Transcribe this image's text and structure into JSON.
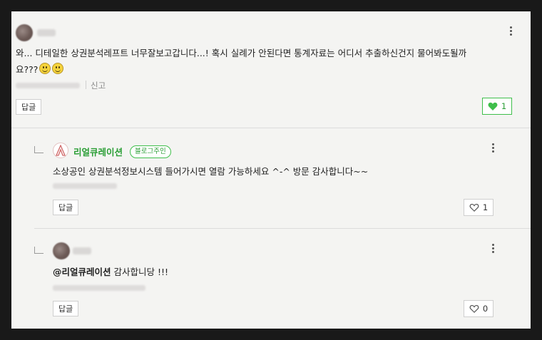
{
  "comments": [
    {
      "text": "와... 디테일한 상권분석레프트 너무잘보고갑니다...! 혹시 실례가 안된다면 통계자료는 어디서 추출하신건지 물어봐도될까",
      "text_line2": "요???",
      "report_label": "신고",
      "reply_label": "답글",
      "like_count": "1",
      "like_active": true
    }
  ],
  "replies": [
    {
      "author": "리얼큐레이션",
      "badge": "블로그주인",
      "text": "소상공인 상권분석정보시스템 들어가시면 열람 가능하세요 ^-^ 방문 감사합니다~~",
      "reply_label": "답글",
      "like_count": "1"
    },
    {
      "mention": "@리얼큐레이션",
      "text": "감사합니당 !!!",
      "reply_label": "답글",
      "like_count": "0"
    }
  ],
  "colors": {
    "accent": "#3fbf4b",
    "panel_bg": "#f4f4f2",
    "frame_bg": "#191919"
  },
  "icons": [
    "more-icon",
    "heart-filled-icon",
    "heart-outline-icon",
    "smile-emoji-icon",
    "reply-arrow-icon",
    "blog-avatar-icon"
  ]
}
